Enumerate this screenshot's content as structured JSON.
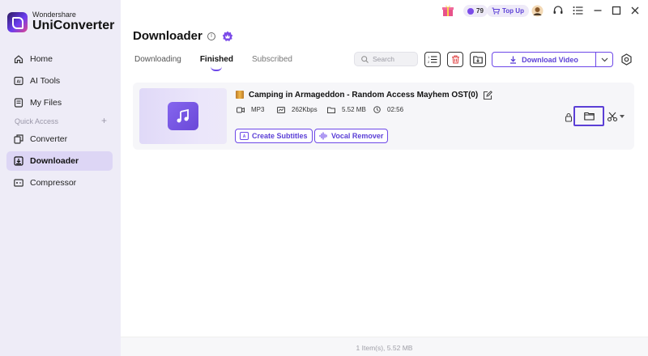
{
  "brand": {
    "company": "Wondershare",
    "product": "UniConverter"
  },
  "sidebar": {
    "items": [
      {
        "label": "Home",
        "icon": "home-icon"
      },
      {
        "label": "AI Tools",
        "icon": "ai-tools-icon"
      },
      {
        "label": "My Files",
        "icon": "my-files-icon"
      },
      {
        "label": "Converter",
        "icon": "converter-icon"
      },
      {
        "label": "Downloader",
        "icon": "downloader-icon",
        "active": true
      },
      {
        "label": "Compressor",
        "icon": "compressor-icon"
      }
    ],
    "quick_access_label": "Quick Access"
  },
  "topbar": {
    "coins": "79",
    "topup_label": "Top Up"
  },
  "page": {
    "title": "Downloader",
    "tabs": [
      "Downloading",
      "Finished",
      "Subscribed"
    ],
    "active_tab": "Finished",
    "search_placeholder": "Search",
    "download_label": "Download Video"
  },
  "file": {
    "title": "Camping in Armageddon - Random Access Mayhem OST(0)",
    "format": "MP3",
    "bitrate": "262Kbps",
    "size": "5.52 MB",
    "duration": "02:56",
    "actions": [
      "Create Subtitles",
      "Vocal Remover"
    ]
  },
  "footer": {
    "summary": "1 Item(s), 5.52 MB"
  },
  "colors": {
    "accent": "#6d48e8",
    "sidebar_bg": "#eeecf7",
    "active_nav": "#ddd6f5"
  }
}
